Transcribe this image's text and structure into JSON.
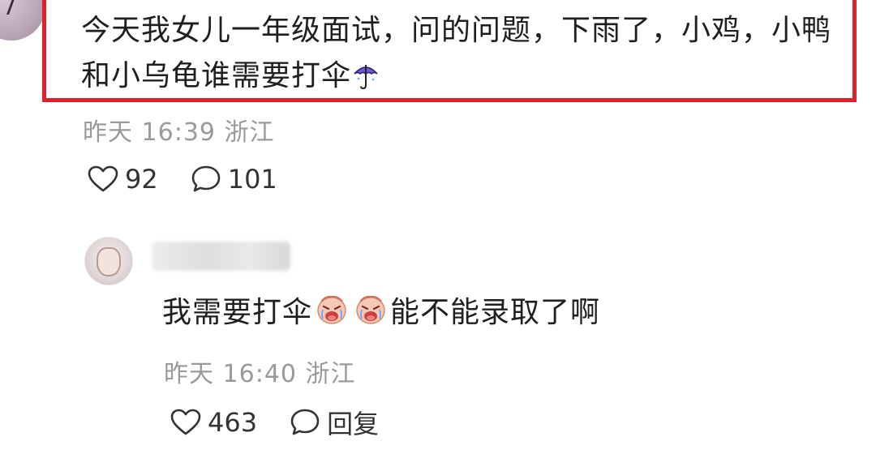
{
  "post": {
    "text": "今天我女儿一年级面试，问的问题，下雨了，小鸡，小鸭和小乌龟谁需要打伞",
    "trailing_icon": "umbrella-icon",
    "time": "昨天 16:39",
    "location": "浙江",
    "likes": "92",
    "comments": "101"
  },
  "reply": {
    "text_before": "我需要打伞",
    "emojis": [
      "crying-emoji",
      "crying-emoji"
    ],
    "text_after": "能不能录取了啊",
    "time": "昨天 16:40",
    "location": "浙江",
    "likes": "463",
    "reply_label": "回复"
  },
  "colors": {
    "highlight_border": "#e0212b",
    "meta_text": "#9a9a9a",
    "body_text": "#1f1f1f"
  }
}
